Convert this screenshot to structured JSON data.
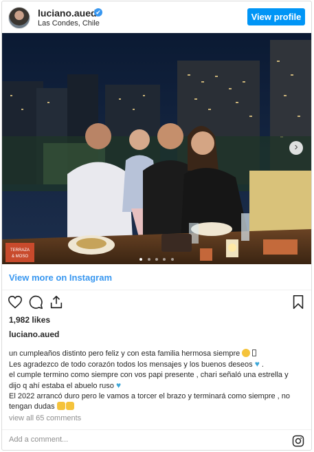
{
  "header": {
    "username": "luciano.aued",
    "verified_mark": "✔",
    "location": "Las Condes, Chile",
    "view_profile_label": "View profile"
  },
  "photo": {
    "carousel_count": 5,
    "carousel_active_index": 0,
    "next_arrow": "›",
    "sign_text_1": "TERRAZA",
    "sign_text_2": "& MOSO"
  },
  "view_more_label": "View more on Instagram",
  "icons": {
    "like": "heart-icon",
    "comment": "comment-icon",
    "share": "share-icon",
    "save": "bookmark-icon",
    "instagram": "instagram-icon"
  },
  "likes_text": "1,982 likes",
  "caption": {
    "username": "luciano.aued",
    "lines": [
      "un cumpleaños distinto pero feliz y con esta familia hermosa siempre",
      "Les agradezco de todo corazón todos los mensajes y los buenos deseos",
      "el cumple termino como siempre con vos papi presente , chari señaló una estrella y",
      "dijo q ahí estaba el abuelo ruso",
      "El 2022 arrancó duro pero le vamos a torcer el brazo y terminará como siempre , no",
      "tengan dudas"
    ],
    "line2_suffix": " .",
    "colors": {
      "blue_heart": "#3aa6d8",
      "emoji_yellow": "#f5c33b"
    }
  },
  "view_comments_label": "view all 65 comments",
  "comment_placeholder": "Add a comment...",
  "accent_color": "#0095f6"
}
